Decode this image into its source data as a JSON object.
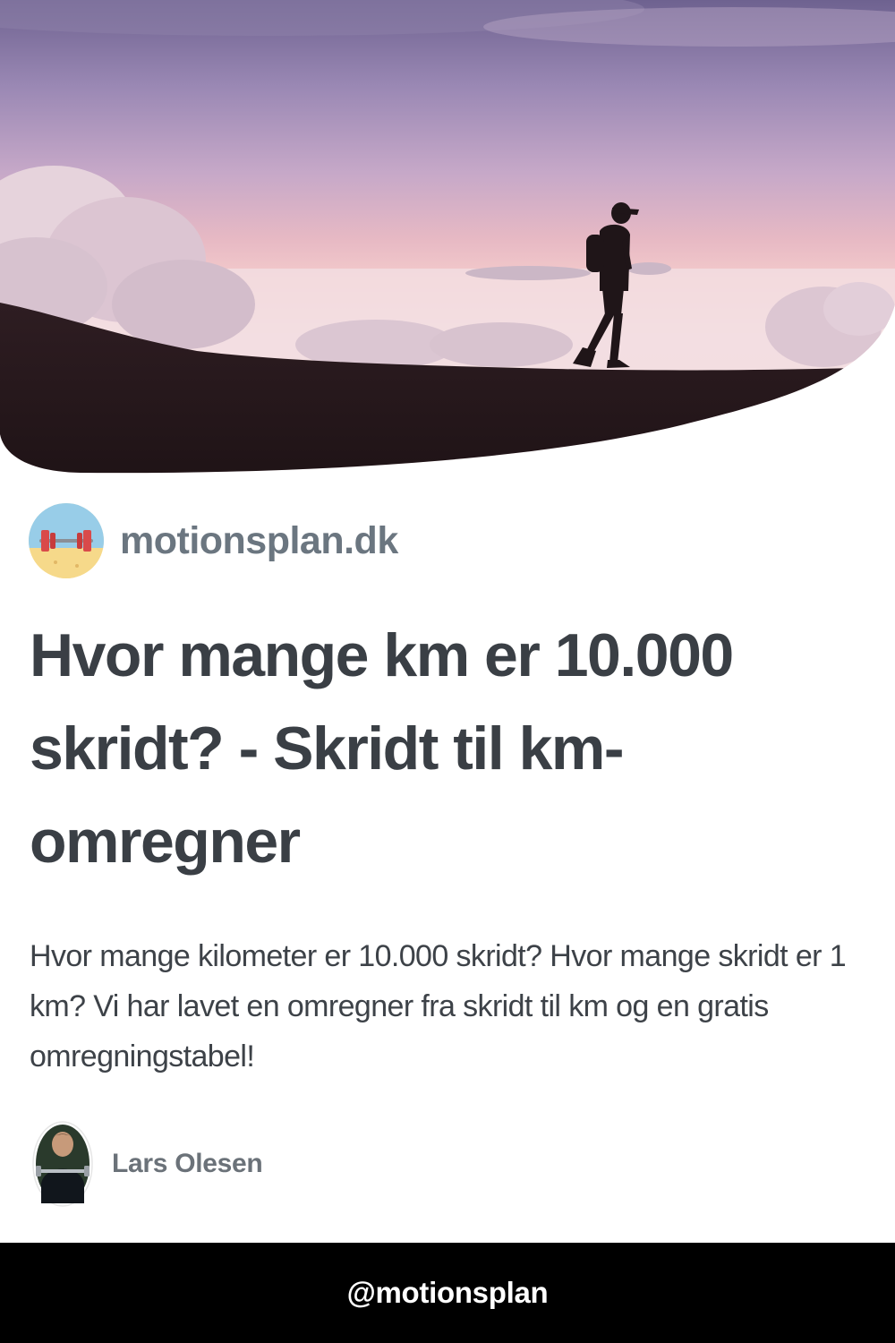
{
  "site": {
    "name": "motionsplan.dk",
    "logo_icon": "dumbbell-beach-icon"
  },
  "article": {
    "title": "Hvor mange km er 10.000 skridt? - Skridt til km-omregner",
    "description": "Hvor mange kilometer er 10.000 skridt? Hvor mange skridt er 1 km? Vi har lavet en omregner fra skridt til km og en gratis omregningstabel!"
  },
  "author": {
    "name": "Lars Olesen"
  },
  "footer": {
    "handle": "@motionsplan"
  },
  "colors": {
    "title": "#3a3f45",
    "site_name": "#6b7680",
    "footer_bg": "#000000",
    "footer_text": "#ffffff"
  }
}
